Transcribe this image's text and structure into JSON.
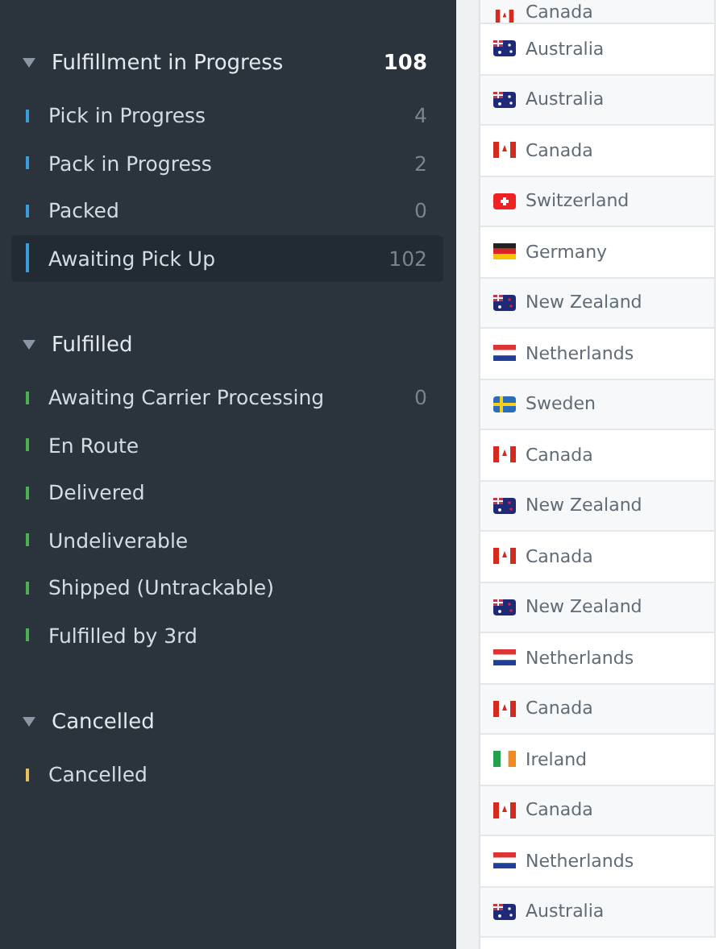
{
  "sidebar": {
    "groups": [
      {
        "title": "Fulfillment in Progress",
        "count": "108",
        "expanded": true,
        "items": [
          {
            "label": "Pick in Progress",
            "count": "4",
            "color": "#3b9ad9",
            "selected": false
          },
          {
            "label": "Pack in Progress",
            "count": "2",
            "color": "#3b9ad9",
            "selected": false
          },
          {
            "label": "Packed",
            "count": "0",
            "color": "#3b9ad9",
            "selected": false
          },
          {
            "label": "Awaiting Pick Up",
            "count": "102",
            "color": "#3b9ad9",
            "selected": true
          }
        ]
      },
      {
        "title": "Fulfilled",
        "expanded": true,
        "items": [
          {
            "label": "Awaiting Carrier Processing",
            "count": "0",
            "color": "#4caf50",
            "selected": false
          },
          {
            "label": "En Route",
            "color": "#4caf50",
            "selected": false
          },
          {
            "label": "Delivered",
            "color": "#4caf50",
            "selected": false
          },
          {
            "label": "Undeliverable",
            "color": "#4caf50",
            "selected": false
          },
          {
            "label": "Shipped (Untrackable)",
            "color": "#4caf50",
            "selected": false
          },
          {
            "label": "Fulfilled by 3rd",
            "color": "#4caf50",
            "selected": false
          }
        ]
      },
      {
        "title": "Cancelled",
        "expanded": true,
        "items": [
          {
            "label": "Cancelled",
            "color": "#e3c25b",
            "selected": false
          }
        ]
      }
    ]
  },
  "table": {
    "rows": [
      {
        "country": "Canada",
        "kind": "canada"
      },
      {
        "country": "Australia",
        "kind": "australia"
      },
      {
        "country": "Australia",
        "kind": "australia"
      },
      {
        "country": "Canada",
        "kind": "canada"
      },
      {
        "country": "Switzerland",
        "kind": "switzerland"
      },
      {
        "country": "Germany",
        "kind": "germany"
      },
      {
        "country": "New Zealand",
        "kind": "newzealand"
      },
      {
        "country": "Netherlands",
        "kind": "netherlands"
      },
      {
        "country": "Sweden",
        "kind": "sweden"
      },
      {
        "country": "Canada",
        "kind": "canada"
      },
      {
        "country": "New Zealand",
        "kind": "newzealand"
      },
      {
        "country": "Canada",
        "kind": "canada"
      },
      {
        "country": "New Zealand",
        "kind": "newzealand"
      },
      {
        "country": "Netherlands",
        "kind": "netherlands"
      },
      {
        "country": "Canada",
        "kind": "canada"
      },
      {
        "country": "Ireland",
        "kind": "ireland"
      },
      {
        "country": "Canada",
        "kind": "canada"
      },
      {
        "country": "Netherlands",
        "kind": "netherlands"
      },
      {
        "country": "Australia",
        "kind": "australia"
      }
    ]
  }
}
